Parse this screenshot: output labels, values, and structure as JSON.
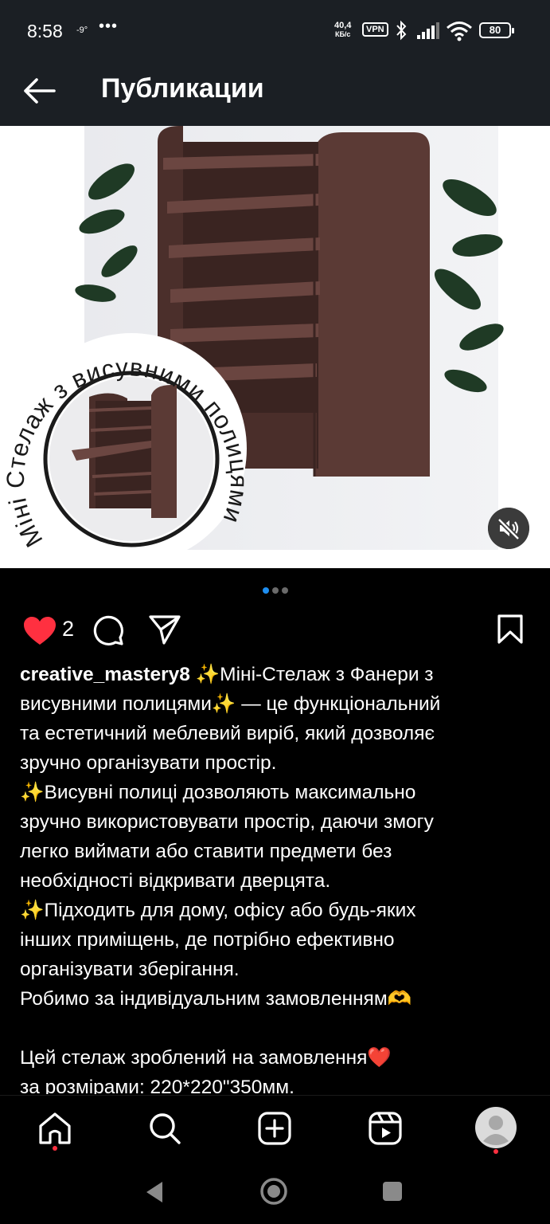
{
  "status_bar": {
    "time": "8:58",
    "temperature": "-9°",
    "more": "•••",
    "net_speed_value": "40,4",
    "net_speed_unit": "КБ/с",
    "vpn": "VPN",
    "battery": "80"
  },
  "header": {
    "title": "Публикации"
  },
  "post": {
    "image_overlay_text": "Міні Стелаж з висувними полицями",
    "carousel": {
      "count": 3,
      "active": 1
    },
    "likes": "2",
    "username": "creative_mastery8",
    "caption_lines": [
      " ✨Міні-Стелаж з Фанери з",
      "висувними полицями✨ — це функціональний",
      "та естетичний меблевий виріб, який дозволяє",
      "зручно організувати простір.",
      "✨Висувні полиці дозволяють максимально",
      "зручно використовувати простір, даючи змогу",
      "легко виймати або ставити предмети без",
      "необхідності відкривати дверцята.",
      "✨Підходить для дому, офісу або будь-яких",
      "інших приміщень, де потрібно ефективно",
      "організувати зберігання.",
      "Робимо за індивідуальним замовленням🫶",
      "",
      "Цей стелаж зроблений на замовлення❤️",
      "за розмірами: 220*220\"350мм."
    ]
  },
  "icons": {
    "back": "arrow-left-icon",
    "like": "heart-icon",
    "comment": "comment-icon",
    "share": "send-icon",
    "save": "bookmark-icon",
    "mute": "speaker-muted-icon",
    "home": "home-icon",
    "search": "search-icon",
    "create": "plus-square-icon",
    "reels": "reels-icon",
    "profile": "profile-avatar-icon"
  },
  "colors": {
    "background": "#000000",
    "bar": "#1b1f24",
    "like": "#ff3040",
    "dot_active": "#1e8ef0",
    "wood": "#5b3a35"
  }
}
